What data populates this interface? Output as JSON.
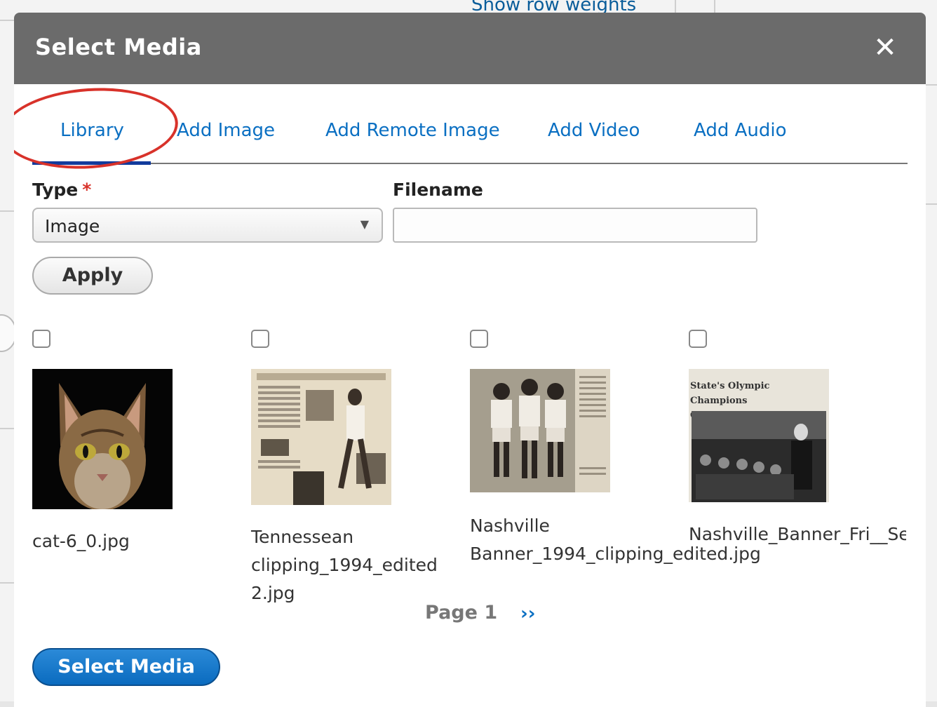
{
  "background": {
    "top_link": "Show row weights"
  },
  "modal": {
    "title": "Select Media",
    "close_glyph": "✕"
  },
  "tabs": [
    {
      "label": "Library",
      "active": true
    },
    {
      "label": "Add Image"
    },
    {
      "label": "Add Remote Image"
    },
    {
      "label": "Add Video"
    },
    {
      "label": "Add Audio"
    }
  ],
  "filters": {
    "type_label": "Type",
    "required_mark": "*",
    "type_value": "Image",
    "filename_label": "Filename",
    "filename_value": "",
    "apply_label": "Apply"
  },
  "media": [
    {
      "caption": "cat-6_0.jpg",
      "icon": "cat-photo"
    },
    {
      "caption": "Tennessean\nclipping_1994_edited\n2.jpg",
      "icon": "newspaper-clipping"
    },
    {
      "caption": "Nashville\nBanner_1994_clipping_edited.jpg",
      "icon": "athletes-photo-clipping"
    },
    {
      "caption": "Nashville_Banner_Fri__Se",
      "icon": "newspaper-clipping"
    }
  ],
  "clipping_headline": "State's Olympic Champions\nGet Stirring Reception",
  "pager": {
    "label": "Page 1",
    "next": "››"
  },
  "select_button": "Select Media",
  "colors": {
    "header": "#6b6b6b",
    "link": "#0a6fc2",
    "highlight": "#d8322a",
    "primary": "#0a6bbf"
  }
}
